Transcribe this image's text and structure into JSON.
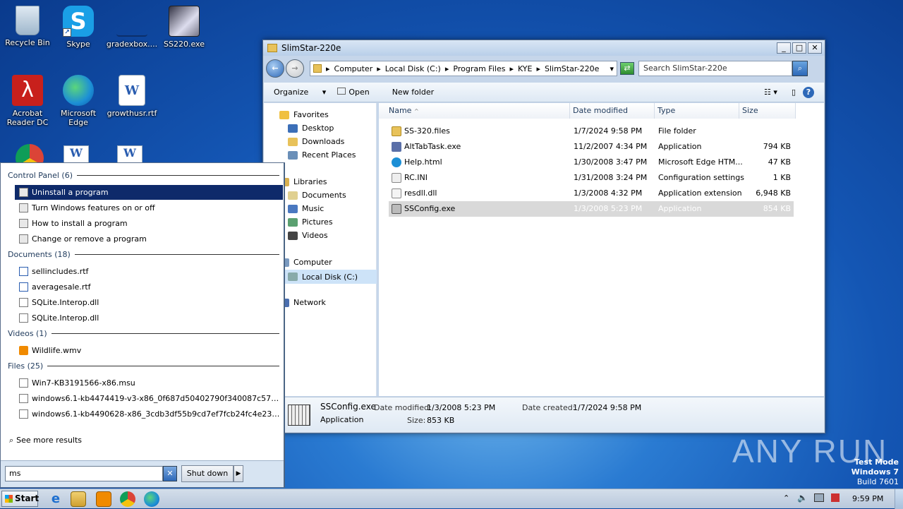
{
  "desktop": {
    "icons": [
      {
        "label": "Recycle Bin"
      },
      {
        "label": "Skype"
      },
      {
        "label": "gradexbox...."
      },
      {
        "label": "SS220.exe"
      },
      {
        "label": "Acrobat Reader DC"
      },
      {
        "label": "Microsoft Edge"
      },
      {
        "label": "growthusr.rtf"
      }
    ],
    "watermark": "ANY RUN",
    "testmode": {
      "line1": "Test Mode",
      "line2": "Windows 7",
      "line3": "Build 7601"
    }
  },
  "explorer": {
    "title": "SlimStar-220e",
    "breadcrumb": [
      "Computer",
      "Local Disk (C:)",
      "Program Files",
      "KYE",
      "SlimStar-220e"
    ],
    "search_placeholder": "Search SlimStar-220e",
    "toolbar": {
      "organize": "Organize",
      "open": "Open",
      "new_folder": "New folder"
    },
    "nav": {
      "favorites": "Favorites",
      "desktop": "Desktop",
      "downloads": "Downloads",
      "recent": "Recent Places",
      "libraries": "Libraries",
      "documents": "Documents",
      "music": "Music",
      "pictures": "Pictures",
      "videos": "Videos",
      "computer": "Computer",
      "localdisk": "Local Disk (C:)",
      "network": "Network"
    },
    "columns": {
      "name": "Name",
      "date": "Date modified",
      "type": "Type",
      "size": "Size"
    },
    "files": [
      {
        "name": "SS-320.files",
        "date": "1/7/2024 9:58 PM",
        "type": "File folder",
        "size": ""
      },
      {
        "name": "AltTabTask.exe",
        "date": "11/2/2007 4:34 PM",
        "type": "Application",
        "size": "794 KB"
      },
      {
        "name": "Help.html",
        "date": "1/30/2008 3:47 PM",
        "type": "Microsoft Edge HTM...",
        "size": "47 KB"
      },
      {
        "name": "RC.INI",
        "date": "1/31/2008 3:24 PM",
        "type": "Configuration settings",
        "size": "1 KB"
      },
      {
        "name": "resdll.dll",
        "date": "1/3/2008 4:32 PM",
        "type": "Application extension",
        "size": "6,948 KB"
      },
      {
        "name": "SSConfig.exe",
        "date": "1/3/2008 5:23 PM",
        "type": "Application",
        "size": "854 KB"
      }
    ],
    "details": {
      "filename": "SSConfig.exe",
      "filetype": "Application",
      "modified_label": "Date modified:",
      "modified": "1/3/2008 5:23 PM",
      "size_label": "Size:",
      "size": "853 KB",
      "created_label": "Date created:",
      "created": "1/7/2024 9:58 PM"
    }
  },
  "startmenu": {
    "groups": {
      "control_panel": "Control Panel (6)",
      "documents": "Documents (18)",
      "videos": "Videos (1)",
      "files": "Files (25)"
    },
    "control_items": [
      "Uninstall a program",
      "Turn Windows features on or off",
      "How to install a program",
      "Change or remove a program"
    ],
    "doc_items": [
      "sellincludes.rtf",
      "averagesale.rtf",
      "SQLite.Interop.dll",
      "SQLite.Interop.dll"
    ],
    "video_items": [
      "Wildlife.wmv"
    ],
    "file_items": [
      "Win7-KB3191566-x86.msu",
      "windows6.1-kb4474419-v3-x86_0f687d50402790f340087c576886501...",
      "windows6.1-kb4490628-x86_3cdb3df55b9cd7ef7fcb24fc4e237ea287a..."
    ],
    "see_more": "See more results",
    "search_value": "ms",
    "shutdown": "Shut down"
  },
  "taskbar": {
    "start": "Start",
    "clock": "9:59 PM"
  }
}
